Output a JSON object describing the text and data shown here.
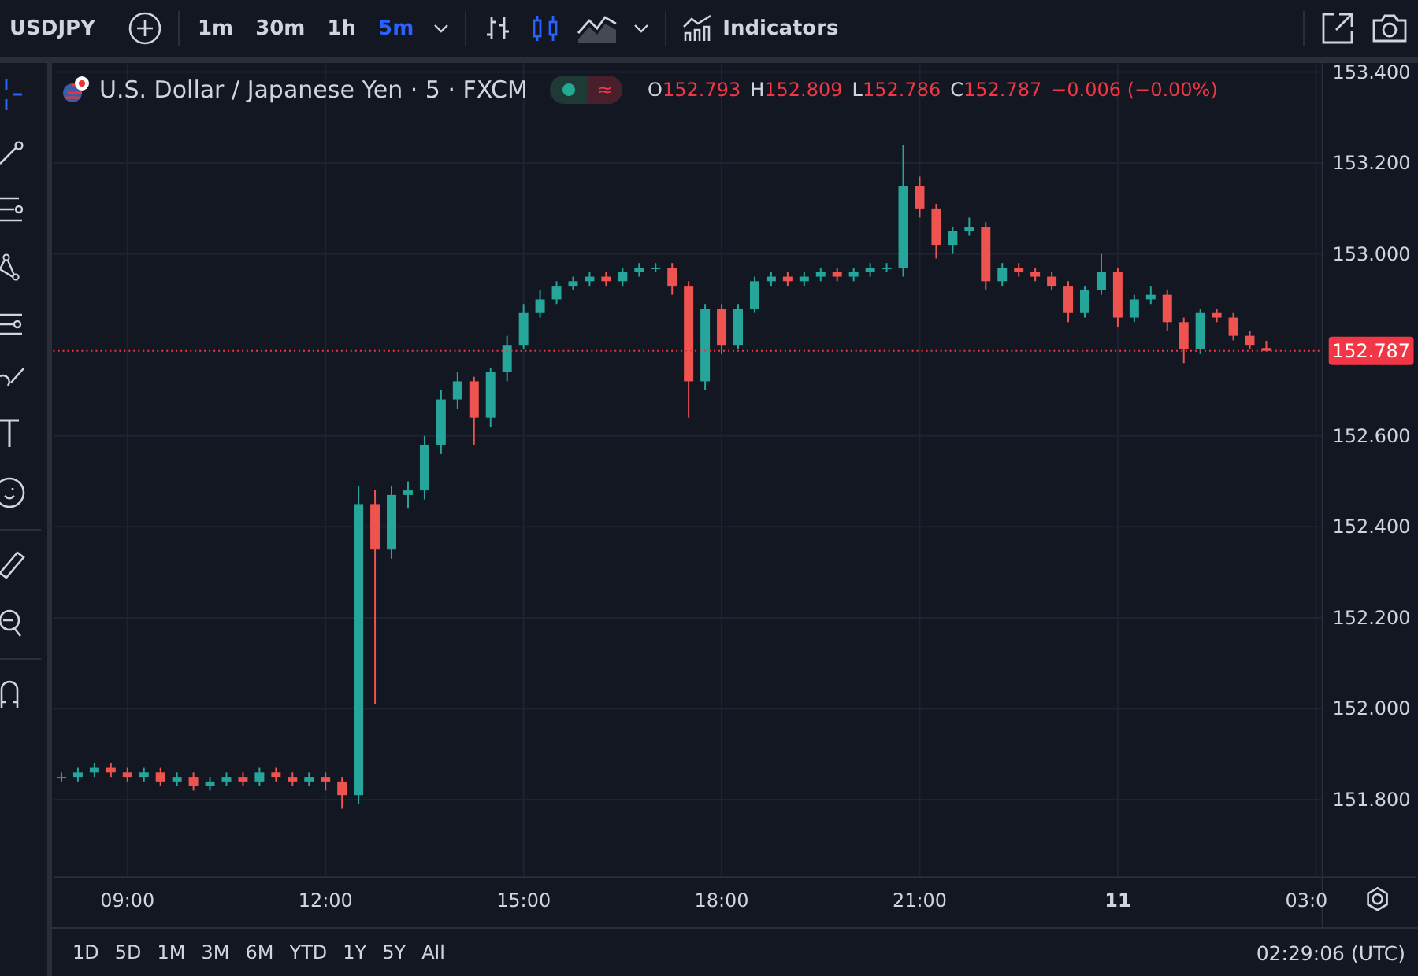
{
  "toolbar": {
    "symbol": "USDJPY",
    "intervals": [
      {
        "label": "1m",
        "selected": false
      },
      {
        "label": "30m",
        "selected": false
      },
      {
        "label": "1h",
        "selected": false
      },
      {
        "label": "5m",
        "selected": true
      }
    ],
    "chart_types": [
      {
        "kind": "bars",
        "selected": false
      },
      {
        "kind": "candles",
        "selected": true
      },
      {
        "kind": "area",
        "selected": false
      }
    ],
    "indicators": "Indicators"
  },
  "legend": {
    "title": "U.S. Dollar / Japanese Yen · 5 · FXCM",
    "market_open": true,
    "status_symbol": "≈",
    "ohlc": [
      {
        "label": "O",
        "value": "152.793"
      },
      {
        "label": "H",
        "value": "152.809"
      },
      {
        "label": "L",
        "value": "152.786"
      },
      {
        "label": "C",
        "value": "152.787"
      }
    ],
    "change": "−0.006 (−0.00%)"
  },
  "chart": {
    "chart_data": {
      "type": "candlestick",
      "grid": true,
      "ylim": [
        151.63,
        153.42
      ],
      "ref_lines": [
        {
          "axis": "y",
          "value": 152.787,
          "label": "152.787",
          "color": "#f23645"
        }
      ],
      "categories": [
        null,
        null,
        null,
        null,
        "09:00",
        null,
        null,
        null,
        null,
        null,
        null,
        null,
        null,
        null,
        null,
        null,
        "12:00",
        null,
        null,
        null,
        null,
        null,
        null,
        null,
        null,
        null,
        null,
        null,
        "15:00",
        null,
        null,
        null,
        null,
        null,
        null,
        null,
        null,
        null,
        null,
        null,
        "18:00",
        null,
        null,
        null,
        null,
        null,
        null,
        null,
        null,
        null,
        null,
        null,
        "21:00",
        null,
        null,
        null,
        null,
        null,
        null,
        null,
        null,
        null,
        null,
        null,
        "11",
        null,
        null,
        null,
        null,
        null,
        null,
        null,
        null,
        null,
        null,
        null,
        "03:0"
      ],
      "yticks": [
        {
          "value": 153.4,
          "label": "153.400"
        },
        {
          "value": 153.2,
          "label": "153.200"
        },
        {
          "value": 153.0,
          "label": "153.000"
        },
        {
          "value": 152.6,
          "label": "152.600"
        },
        {
          "value": 152.4,
          "label": "152.400"
        },
        {
          "value": 152.2,
          "label": "152.200"
        },
        {
          "value": 152.0,
          "label": "152.000"
        },
        {
          "value": 151.8,
          "label": "151.800"
        }
      ],
      "ohlc": [
        [
          151.85,
          151.86,
          151.84,
          151.85
        ],
        [
          151.85,
          151.87,
          151.84,
          151.86
        ],
        [
          151.86,
          151.88,
          151.85,
          151.87
        ],
        [
          151.87,
          151.88,
          151.85,
          151.86
        ],
        [
          151.86,
          151.87,
          151.84,
          151.85
        ],
        [
          151.85,
          151.87,
          151.84,
          151.86
        ],
        [
          151.86,
          151.87,
          151.83,
          151.84
        ],
        [
          151.84,
          151.86,
          151.83,
          151.85
        ],
        [
          151.85,
          151.86,
          151.82,
          151.83
        ],
        [
          151.83,
          151.85,
          151.82,
          151.84
        ],
        [
          151.84,
          151.86,
          151.83,
          151.85
        ],
        [
          151.85,
          151.86,
          151.83,
          151.84
        ],
        [
          151.84,
          151.87,
          151.83,
          151.86
        ],
        [
          151.86,
          151.87,
          151.84,
          151.85
        ],
        [
          151.85,
          151.86,
          151.83,
          151.84
        ],
        [
          151.84,
          151.86,
          151.83,
          151.85
        ],
        [
          151.85,
          151.86,
          151.82,
          151.84
        ],
        [
          151.84,
          151.85,
          151.78,
          151.81
        ],
        [
          151.81,
          152.49,
          151.79,
          152.45
        ],
        [
          152.45,
          152.48,
          152.01,
          152.35
        ],
        [
          152.35,
          152.49,
          152.33,
          152.47
        ],
        [
          152.47,
          152.5,
          152.44,
          152.48
        ],
        [
          152.48,
          152.6,
          152.46,
          152.58
        ],
        [
          152.58,
          152.7,
          152.56,
          152.68
        ],
        [
          152.68,
          152.74,
          152.66,
          152.72
        ],
        [
          152.72,
          152.73,
          152.58,
          152.64
        ],
        [
          152.64,
          152.75,
          152.62,
          152.74
        ],
        [
          152.74,
          152.82,
          152.72,
          152.8
        ],
        [
          152.8,
          152.89,
          152.79,
          152.87
        ],
        [
          152.87,
          152.92,
          152.86,
          152.9
        ],
        [
          152.9,
          152.94,
          152.89,
          152.93
        ],
        [
          152.93,
          152.95,
          152.92,
          152.94
        ],
        [
          152.94,
          152.96,
          152.93,
          152.95
        ],
        [
          152.95,
          152.96,
          152.93,
          152.94
        ],
        [
          152.94,
          152.97,
          152.93,
          152.96
        ],
        [
          152.96,
          152.98,
          152.95,
          152.97
        ],
        [
          152.97,
          152.98,
          152.96,
          152.97
        ],
        [
          152.97,
          152.98,
          152.91,
          152.93
        ],
        [
          152.93,
          152.94,
          152.64,
          152.72
        ],
        [
          152.72,
          152.89,
          152.7,
          152.88
        ],
        [
          152.88,
          152.89,
          152.78,
          152.8
        ],
        [
          152.8,
          152.89,
          152.79,
          152.88
        ],
        [
          152.88,
          152.95,
          152.87,
          152.94
        ],
        [
          152.94,
          152.96,
          152.93,
          152.95
        ],
        [
          152.95,
          152.96,
          152.93,
          152.94
        ],
        [
          152.94,
          152.96,
          152.93,
          152.95
        ],
        [
          152.95,
          152.97,
          152.94,
          152.96
        ],
        [
          152.96,
          152.97,
          152.94,
          152.95
        ],
        [
          152.95,
          152.97,
          152.94,
          152.96
        ],
        [
          152.96,
          152.98,
          152.95,
          152.97
        ],
        [
          152.97,
          152.98,
          152.96,
          152.97
        ],
        [
          152.97,
          153.24,
          152.95,
          153.15
        ],
        [
          153.15,
          153.17,
          153.08,
          153.1
        ],
        [
          153.1,
          153.11,
          152.99,
          153.02
        ],
        [
          153.02,
          153.06,
          153.0,
          153.05
        ],
        [
          153.05,
          153.08,
          153.04,
          153.06
        ],
        [
          153.06,
          153.07,
          152.92,
          152.94
        ],
        [
          152.94,
          152.98,
          152.93,
          152.97
        ],
        [
          152.97,
          152.98,
          152.95,
          152.96
        ],
        [
          152.96,
          152.97,
          152.94,
          152.95
        ],
        [
          152.95,
          152.96,
          152.92,
          152.93
        ],
        [
          152.93,
          152.94,
          152.85,
          152.87
        ],
        [
          152.87,
          152.93,
          152.86,
          152.92
        ],
        [
          152.92,
          153.0,
          152.91,
          152.96
        ],
        [
          152.96,
          152.97,
          152.84,
          152.86
        ],
        [
          152.86,
          152.91,
          152.85,
          152.9
        ],
        [
          152.9,
          152.93,
          152.89,
          152.91
        ],
        [
          152.91,
          152.92,
          152.83,
          152.85
        ],
        [
          152.85,
          152.86,
          152.76,
          152.79
        ],
        [
          152.79,
          152.88,
          152.78,
          152.87
        ],
        [
          152.87,
          152.88,
          152.85,
          152.86
        ],
        [
          152.86,
          152.87,
          152.81,
          152.82
        ],
        [
          152.82,
          152.83,
          152.79,
          152.8
        ],
        [
          152.793,
          152.809,
          152.786,
          152.787
        ],
        null,
        null,
        null
      ]
    }
  },
  "ranges": [
    "1D",
    "5D",
    "1M",
    "3M",
    "6M",
    "YTD",
    "1Y",
    "5Y",
    "All"
  ],
  "clock": "02:29:06 (UTC)"
}
